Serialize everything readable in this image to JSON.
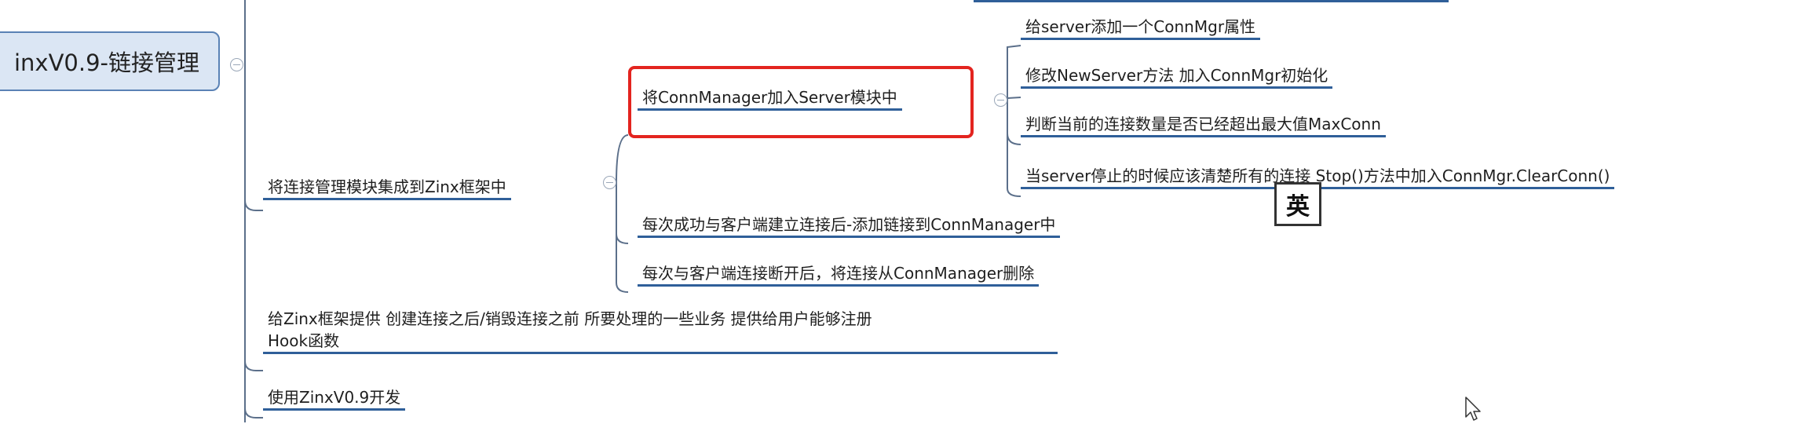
{
  "root": {
    "label": "inxV0.9-链接管理"
  },
  "branches": [
    {
      "label": "将连接管理模块集成到Zinx框架中",
      "children": [
        {
          "label": "将ConnManager加入Server模块中",
          "highlighted": true,
          "children": [
            {
              "label": "给server添加一个ConnMgr属性"
            },
            {
              "label": "修改NewServer方法 加入ConnMgr初始化"
            },
            {
              "label": "判断当前的连接数量是否已经超出最大值MaxConn"
            },
            {
              "label": "当server停止的时候应该清楚所有的连接 Stop()方法中加入ConnMgr.ClearConn()"
            }
          ]
        },
        {
          "label": "每次成功与客户端建立连接后-添加链接到ConnManager中"
        },
        {
          "label": "每次与客户端连接断开后，将连接从ConnManager删除"
        }
      ]
    },
    {
      "label_line1": "给Zinx框架提供 创建连接之后/销毁连接之前 所要处理的一些业务 提供给用户能够注册",
      "label_line2": "Hook函数"
    },
    {
      "label": "使用ZinxV0.9开发"
    }
  ],
  "overlay": {
    "ime_badge": "英"
  },
  "colors": {
    "highlight_border": "#e3241f",
    "root_fill": "#dbe6f4",
    "root_border": "#5a82b5",
    "branch_underline": "#2f5f99",
    "connector": "#5b6f8a"
  }
}
